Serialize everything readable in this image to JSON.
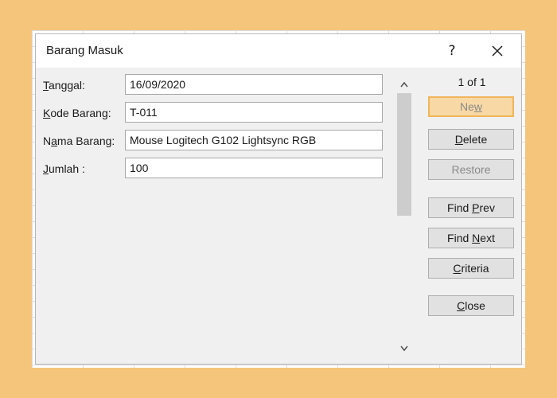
{
  "dialog": {
    "title": "Barang Masuk",
    "help_label": "?"
  },
  "fields": [
    {
      "label_mnemonic": "T",
      "label_rest": "anggal:",
      "value": "16/09/2020"
    },
    {
      "label_mnemonic": "K",
      "label_rest": "ode Barang:",
      "value": "T-011"
    },
    {
      "label_pre": "N",
      "label_mnemonic": "a",
      "label_rest": "ma Barang:",
      "value": "Mouse Logitech G102 Lightsync RGB"
    },
    {
      "label_mnemonic": "J",
      "label_rest": "umlah :",
      "value": "100"
    }
  ],
  "record_counter": "1 of 1",
  "buttons": {
    "new": {
      "pre": "Ne",
      "mnemonic": "w",
      "post": ""
    },
    "delete": {
      "pre": "",
      "mnemonic": "D",
      "post": "elete"
    },
    "restore": {
      "pre": "",
      "mnemonic": "",
      "post": "Restore"
    },
    "find_prev": {
      "pre": "Find ",
      "mnemonic": "P",
      "post": "rev"
    },
    "find_next": {
      "pre": "Find ",
      "mnemonic": "N",
      "post": "ext"
    },
    "criteria": {
      "pre": "",
      "mnemonic": "C",
      "post": "riteria"
    },
    "close": {
      "pre": "",
      "mnemonic": "C",
      "post": "lose"
    }
  },
  "icons": {
    "help": "question-mark-icon",
    "close": "close-icon",
    "scroll_up": "chevron-up-icon",
    "scroll_down": "chevron-down-icon"
  },
  "colors": {
    "background": "#f6c57c",
    "dialog": "#f0f0f0",
    "default_button": "#f8d9a5"
  }
}
